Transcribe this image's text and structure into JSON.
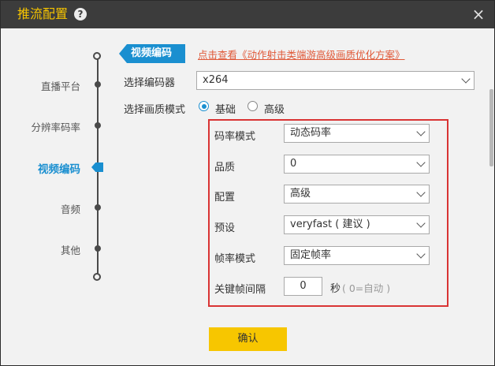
{
  "window": {
    "title": "推流配置",
    "help_icon": "?",
    "close_icon": "×"
  },
  "nav": {
    "items": [
      {
        "label": "直播平台"
      },
      {
        "label": "分辨率码率"
      },
      {
        "label": "视频编码"
      },
      {
        "label": "音频"
      },
      {
        "label": "其他"
      }
    ],
    "active": "视频编码"
  },
  "section": {
    "tag": "视频编码",
    "link": "点击查看《动作射击类端游高级画质优化方案》"
  },
  "encoder": {
    "label": "选择编码器",
    "value": "x264"
  },
  "quality_mode": {
    "label": "选择画质模式",
    "options": [
      "基础",
      "高级"
    ],
    "selected": "基础"
  },
  "settings": {
    "bitrate_mode": {
      "label": "码率模式",
      "value": "动态码率"
    },
    "quality": {
      "label": "品质",
      "value": "0"
    },
    "profile": {
      "label": "配置",
      "value": "高级"
    },
    "preset": {
      "label": "预设",
      "value": "veryfast ( 建议 )"
    },
    "framerate_mode": {
      "label": "帧率模式",
      "value": "固定帧率"
    },
    "keyframe": {
      "label": "关键帧间隔",
      "value": "0",
      "unit": "秒",
      "hint": "( 0=自动 )"
    }
  },
  "confirm_label": "确认",
  "colors": {
    "accent": "#1a8fd0",
    "title": "#f5c300",
    "button": "#f7c600",
    "highlight_border": "#d93434",
    "link": "#e05a3a"
  }
}
